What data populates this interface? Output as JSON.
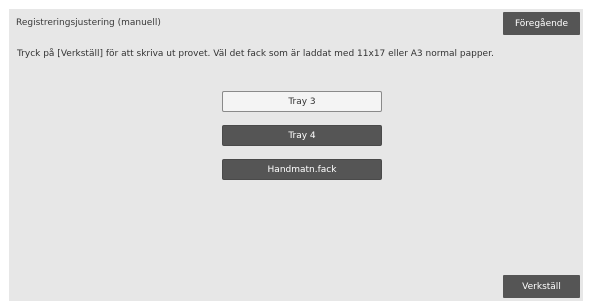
{
  "header": {
    "title": "Registreringsjustering (manuell)",
    "back_label": "Föregående"
  },
  "instruction": "Tryck på [Verkställ] för att skriva ut provet. Väl det fack som är laddat med 11x17 eller A3 normal papper.",
  "trays": [
    {
      "label": "Tray 3",
      "selected": true
    },
    {
      "label": "Tray 4",
      "selected": false
    },
    {
      "label": "Handmatn.fack",
      "selected": false
    }
  ],
  "footer": {
    "execute_label": "Verkställ"
  },
  "colors": {
    "panel_bg": "#e7e7e7",
    "button_dark": "#555555",
    "button_selected": "#f4f4f4",
    "text": "#333333"
  }
}
